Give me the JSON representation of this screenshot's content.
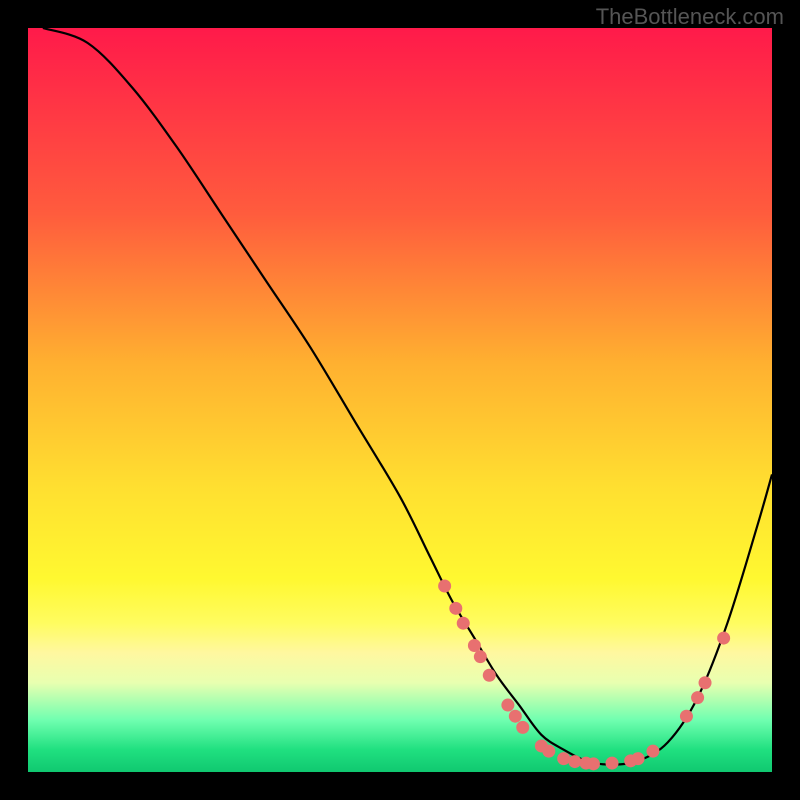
{
  "watermark": "TheBottleneck.com",
  "chart_data": {
    "type": "line",
    "title": "",
    "xlabel": "",
    "ylabel": "",
    "xlim": [
      0,
      100
    ],
    "ylim": [
      0,
      100
    ],
    "curve": {
      "x": [
        2,
        8,
        14,
        20,
        26,
        32,
        38,
        44,
        50,
        54,
        57,
        60,
        63,
        66,
        69,
        72,
        75,
        78,
        82,
        86,
        90,
        94,
        98,
        100
      ],
      "y": [
        100,
        98,
        92,
        84,
        75,
        66,
        57,
        47,
        37,
        29,
        23,
        18,
        13,
        9,
        5,
        3,
        1.5,
        1,
        1.5,
        4,
        10,
        20,
        33,
        40
      ]
    },
    "markers": [
      {
        "x": 56,
        "y": 25
      },
      {
        "x": 57.5,
        "y": 22
      },
      {
        "x": 58.5,
        "y": 20
      },
      {
        "x": 60,
        "y": 17
      },
      {
        "x": 60.8,
        "y": 15.5
      },
      {
        "x": 62,
        "y": 13
      },
      {
        "x": 64.5,
        "y": 9
      },
      {
        "x": 65.5,
        "y": 7.5
      },
      {
        "x": 66.5,
        "y": 6
      },
      {
        "x": 69,
        "y": 3.5
      },
      {
        "x": 70,
        "y": 2.8
      },
      {
        "x": 72,
        "y": 1.8
      },
      {
        "x": 73.5,
        "y": 1.4
      },
      {
        "x": 75,
        "y": 1.2
      },
      {
        "x": 76,
        "y": 1.1
      },
      {
        "x": 78.5,
        "y": 1.2
      },
      {
        "x": 81,
        "y": 1.5
      },
      {
        "x": 82,
        "y": 1.8
      },
      {
        "x": 84,
        "y": 2.8
      },
      {
        "x": 88.5,
        "y": 7.5
      },
      {
        "x": 90,
        "y": 10
      },
      {
        "x": 91,
        "y": 12
      },
      {
        "x": 93.5,
        "y": 18
      }
    ],
    "colors": {
      "curve": "#000000",
      "markers": "#e87070",
      "gradient_top": "#ff1a4a",
      "gradient_bottom": "#10c870"
    }
  }
}
